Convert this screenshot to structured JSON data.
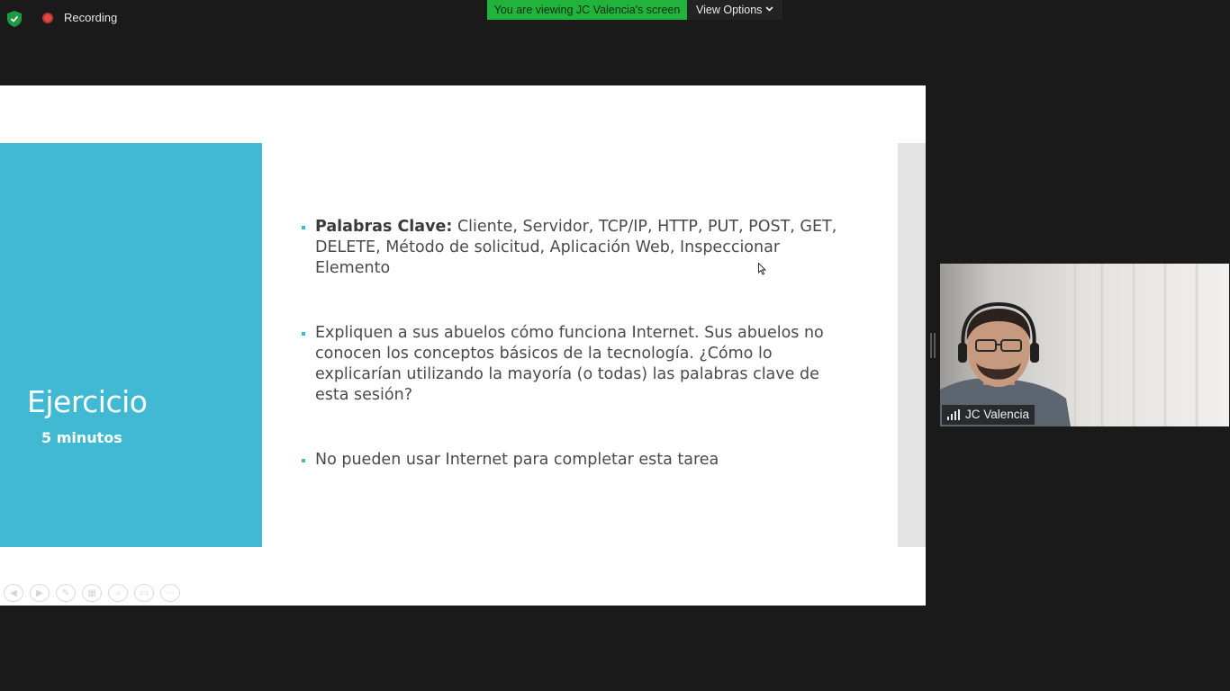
{
  "topbar": {
    "recording_label": "Recording",
    "viewing_banner": "You are viewing JC Valencia's screen",
    "view_options_label": "View Options"
  },
  "slide": {
    "title": "Ejercicio",
    "subtitle": "5 minutos",
    "bullet1_bold": "Palabras Clave:",
    "bullet1_text": " Cliente,  Servidor,  TCP/IP, HTTP, PUT, POST, GET, DELETE, Método de solicitud, Aplicación Web, Inspeccionar Elemento",
    "bullet2_text": "Expliquen a sus abuelos cómo funciona Internet. Sus abuelos no conocen los conceptos básicos de la tecnología. ¿Cómo lo explicarían utilizando la mayoría (o todas) las palabras clave de esta sesión?",
    "bullet3_text": "No pueden usar Internet para completar esta tarea"
  },
  "participant": {
    "name": "JC Valencia"
  },
  "colors": {
    "accent_teal": "#41b9d3",
    "banner_green": "#21b33b",
    "recording_red": "#e5483f"
  }
}
